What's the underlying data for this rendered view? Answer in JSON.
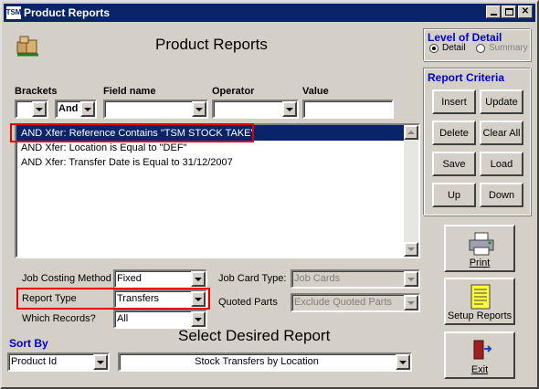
{
  "window": {
    "title": "Product Reports",
    "app_icon": "TSM"
  },
  "header": {
    "title": "Product Reports"
  },
  "level_of_detail": {
    "heading": "Level of Detail",
    "options": [
      "Detail",
      "Summary"
    ],
    "selected": "Detail"
  },
  "criteria_header": {
    "brackets": "Brackets",
    "field_name": "Field name",
    "operator": "Operator",
    "value": "Value"
  },
  "criteria_inputs": {
    "bracket_open": "",
    "connector": "And",
    "field_name": "",
    "operator": "",
    "value": ""
  },
  "criteria_list": [
    "AND Xfer: Reference Contains  \"TSM STOCK TAKE\"",
    "AND Xfer: Location is Equal to  \"DEF\"",
    "AND Xfer: Transfer Date is Equal to 31/12/2007"
  ],
  "report_criteria": {
    "heading": "Report Criteria",
    "buttons": [
      "Insert",
      "Update",
      "Delete",
      "Clear All",
      "Save",
      "Load",
      "Up",
      "Down"
    ]
  },
  "options": {
    "job_costing_method": {
      "label": "Job Costing Method",
      "value": "Fixed"
    },
    "report_type": {
      "label": "Report Type",
      "value": "Transfers"
    },
    "which_records": {
      "label": "Which Records?",
      "value": "All"
    },
    "job_card_type": {
      "label": "Job Card Type:",
      "value": "Job Cards"
    },
    "quoted_parts": {
      "label": "Quoted Parts",
      "value": "Exclude Quoted Parts"
    }
  },
  "select_report": {
    "heading": "Select Desired Report",
    "value": "Stock Transfers by Location"
  },
  "sort_by": {
    "label": "Sort By",
    "value": "Product Id"
  },
  "actions": {
    "print": "Print",
    "setup": "Setup Reports",
    "exit": "Exit"
  },
  "colors": {
    "title_bar": "#0a246a",
    "selection": "#0a246a",
    "highlight_box": "#e00000",
    "heading_blue": "#0000c8"
  }
}
